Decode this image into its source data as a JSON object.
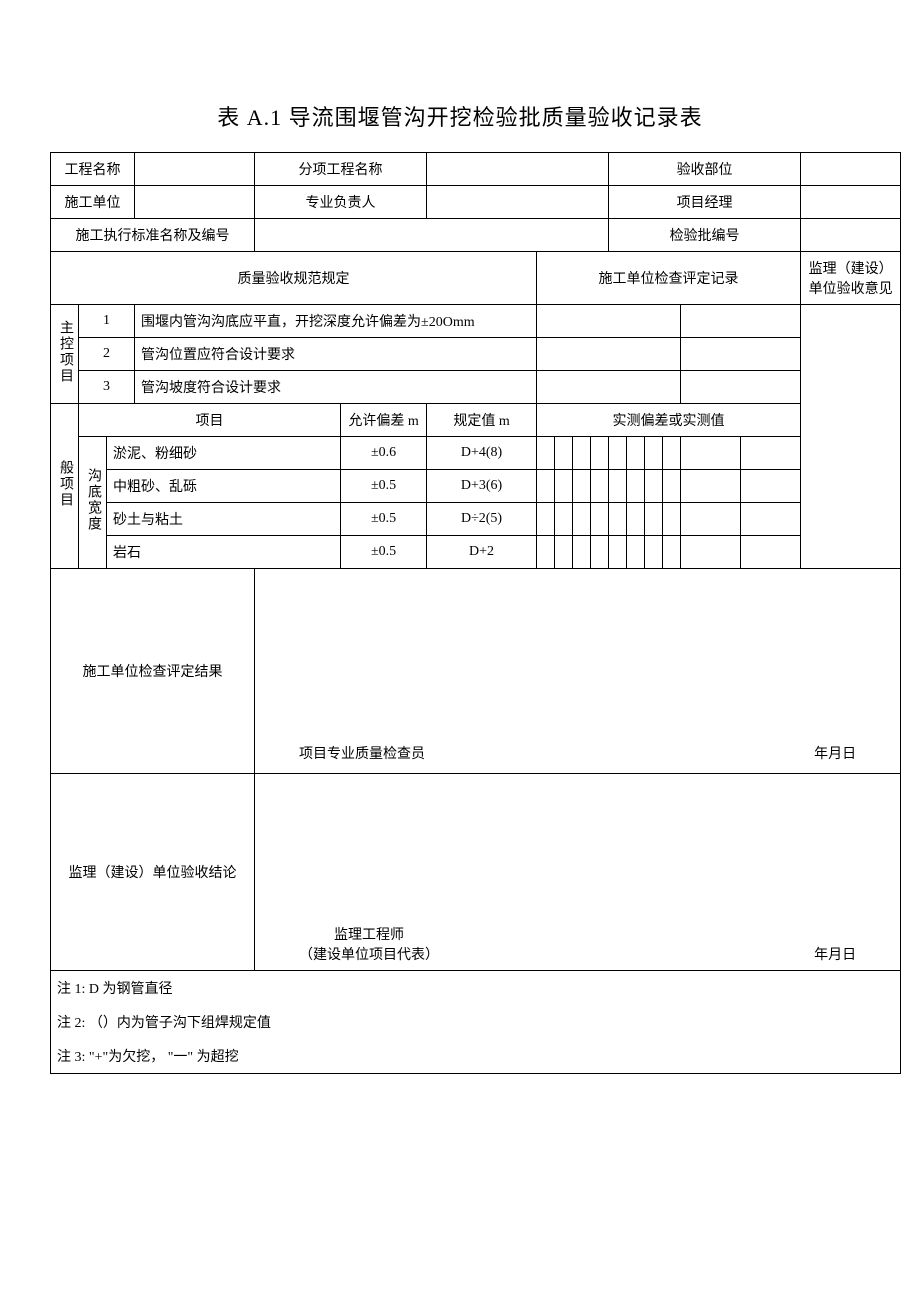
{
  "title": "表 A.1 导流围堰管沟开挖检验批质量验收记录表",
  "header": {
    "projectName": "工程名称",
    "subItemName": "分项工程名称",
    "acceptPart": "验收部位",
    "constructUnit": "施工单位",
    "profLeader": "专业负责人",
    "pm": "项目经理",
    "stdName": "施工执行标准名称及编号",
    "batchNo": "检验批编号"
  },
  "sectionHeads": {
    "qualitySpec": "质量验收规范规定",
    "unitRecord": "施工单位检查评定记录",
    "supervisorOpinion": "监理（建设）单位验收意见"
  },
  "mainItemsLabel": "主控项目",
  "mainItems": {
    "n1": "1",
    "t1": "围堰内管沟沟底应平直，开挖深度允许偏差为±20Omm",
    "n2": "2",
    "t2": "管沟位置应符合设计要求",
    "n3": "3",
    "t3": "管沟坡度符合设计要求"
  },
  "genItemsLabel": "般项目",
  "genHeader": {
    "project": "项目",
    "allow": "允许偏差 m",
    "spec": "规定值 m",
    "measured": "实测偏差或实测值"
  },
  "rowGroupLabel": "沟底宽度",
  "rows": {
    "r1p": "淤泥、粉细砂",
    "r1a": "±0.6",
    "r1s": "D+4(8)",
    "r2p": "中粗砂、乱砾",
    "r2a": "±0.5",
    "r2s": "D+3(6)",
    "r3p": "砂土与粘土",
    "r3a": "±0.5",
    "r3s": "D÷2(5)",
    "r4p": "岩石",
    "r4a": "±0.5",
    "r4s": "D+2"
  },
  "blocks": {
    "unitResultLabel": "施工单位检查评定结果",
    "unitSigner": "项目专业质量检查员",
    "supervisorResultLabel": "监理（建设）单位验收结论",
    "supervisorSigner1": "监理工程师",
    "supervisorSigner2": "（建设单位项目代表）",
    "dateLabel": "年月日"
  },
  "notes": {
    "n1": "注 1:  D 为钢管直径",
    "n2": "注 2: （）内为管子沟下组焊规定值",
    "n3": "注 3: \"+\"为欠挖， \"一\" 为超挖"
  }
}
